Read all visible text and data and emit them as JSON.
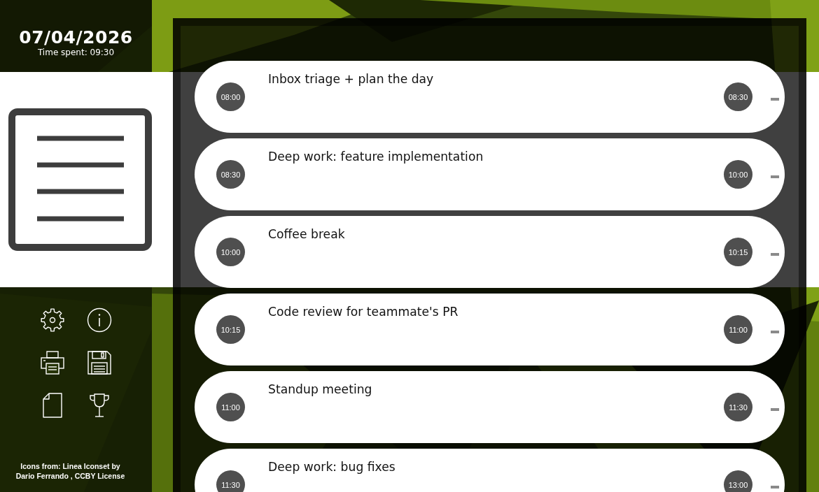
{
  "sidebar": {
    "date": "07/04/2026",
    "time_spent": "Time spent: 09:30",
    "credits": "Icons from: Linea Iconset by Dario Ferrando , CCBY License"
  },
  "tasks": [
    {
      "title": "Inbox triage + plan the day",
      "start": "08:00",
      "end": "08:30"
    },
    {
      "title": "Deep work: feature implementation",
      "start": "08:30",
      "end": "10:00"
    },
    {
      "title": "Coffee break",
      "start": "10:00",
      "end": "10:15"
    },
    {
      "title": "Code review for teammate's PR",
      "start": "10:15",
      "end": "11:00"
    },
    {
      "title": "Standup meeting",
      "start": "11:00",
      "end": "11:30"
    },
    {
      "title": "Deep work: bug fixes",
      "start": "11:30",
      "end": "13:00"
    }
  ]
}
